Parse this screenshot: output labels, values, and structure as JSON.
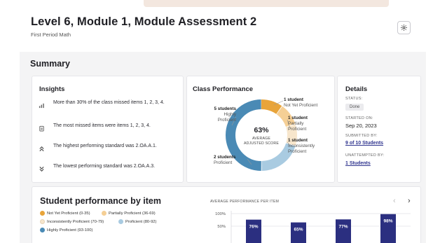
{
  "header": {
    "title": "Level 6, Module 1, Module Assessment 2",
    "subtitle": "First Period Math",
    "settings_icon": "gear-icon"
  },
  "summary": {
    "heading": "Summary",
    "insights": {
      "title": "Insights",
      "items": [
        {
          "icon": "bar-chart-icon",
          "text": "More than 30% of the class missed items 1, 2, 3, 4."
        },
        {
          "icon": "clipboard-icon",
          "text": "The most missed items were items 1, 2, 3, 4."
        },
        {
          "icon": "chevrons-up-icon",
          "text": "The highest performing standard was 2.OA.A.1."
        },
        {
          "icon": "chevrons-down-icon",
          "text": "The lowest performing standard was 2.OA.A.3."
        }
      ]
    },
    "class_performance": {
      "title": "Class Performance",
      "percent": "63%",
      "caption": "AVERAGE ADJUSTED SCORE",
      "segments": [
        {
          "count_label": "1 student",
          "level": "Not Yet Proficient",
          "students": 1,
          "color": "#e8a43a"
        },
        {
          "count_label": "1 student",
          "level": "Partially Proficient",
          "students": 1,
          "color": "#f5cf95"
        },
        {
          "count_label": "1 student",
          "level": "Inconsistently Proficient",
          "students": 1,
          "color": "#f7e6cc"
        },
        {
          "count_label": "2 students",
          "level": "Proficient",
          "students": 2,
          "color": "#a9cbe1"
        },
        {
          "count_label": "5 students",
          "level": "Highly Proficient",
          "students": 5,
          "color": "#4a8ab5"
        }
      ]
    },
    "details": {
      "title": "Details",
      "status_label": "STATUS:",
      "status_value": "Done",
      "started_label": "STARTED ON:",
      "started_value": "Sep 20, 2023",
      "submitted_label": "SUBMITTED BY:",
      "submitted_value": "9 of 10 Students",
      "unattempted_label": "UNATTEMPTED BY:",
      "unattempted_value": "1 Students"
    }
  },
  "by_item": {
    "title": "Student performance by item",
    "legend": [
      {
        "label": "Not Yet Proficient (0-35)",
        "color": "#e8a43a"
      },
      {
        "label": "Partially Proficient (36-69)",
        "color": "#f5cf95"
      },
      {
        "label": "Inconsistently Proficient (70-79)",
        "color": "#f7e6cc"
      },
      {
        "label": "Proficient (80-92)",
        "color": "#a9cbe1"
      },
      {
        "label": "Highly Proficient (93-100)",
        "color": "#4a8ab5"
      }
    ],
    "chart_caption": "AVERAGE PERFORMANCE PER ITEM",
    "prev_icon": "chevron-left-icon",
    "next_icon": "chevron-right-icon"
  },
  "chart_data": {
    "type": "bar",
    "title": "AVERAGE PERFORMANCE PER ITEM",
    "y_ticks": [
      "100%",
      "50%"
    ],
    "ylim": [
      0,
      100
    ],
    "values": [
      76,
      65,
      77,
      98
    ],
    "value_labels": [
      "76%",
      "65%",
      "77%",
      "98%"
    ],
    "bar_color": "#2b2f80"
  }
}
